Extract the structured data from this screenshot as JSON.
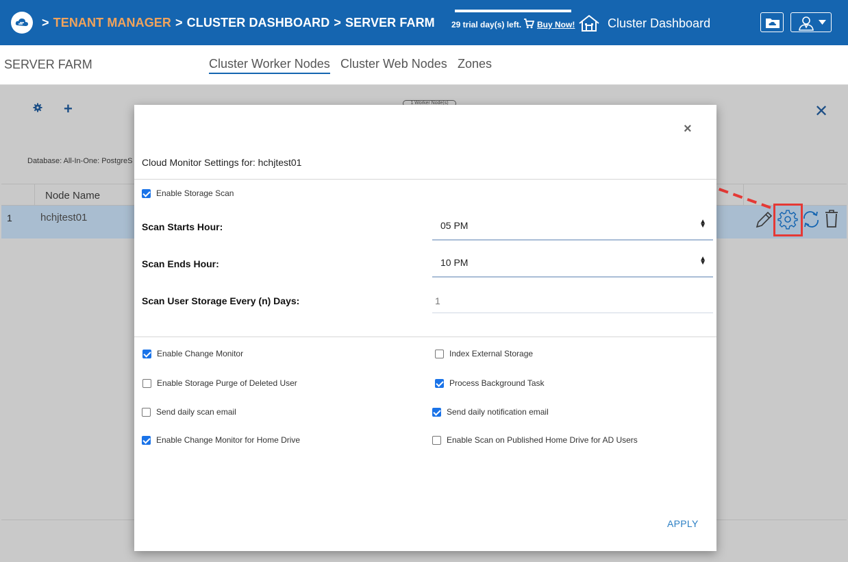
{
  "header": {
    "breadcrumbs": [
      {
        "label": "TENANT MANAGER",
        "color": "#f0a35c"
      },
      {
        "label": "CLUSTER DASHBOARD",
        "color": "#ffffff"
      },
      {
        "label": "SERVER FARM",
        "color": "#ffffff"
      }
    ],
    "separator": ">",
    "trial_text": "29 trial day(s) left.",
    "buy_now": "Buy Now!",
    "dashboard_title": "Cluster Dashboard",
    "icons": [
      "cloud-logo-icon",
      "cart-icon",
      "home-icon",
      "folder-cloud-icon",
      "user-icon",
      "caret-down-icon"
    ]
  },
  "subnav": {
    "title": "SERVER FARM",
    "tabs": [
      {
        "label": "Cluster Worker Nodes",
        "active": true
      },
      {
        "label": "Cluster Web Nodes",
        "active": false
      },
      {
        "label": "Zones",
        "active": false
      }
    ]
  },
  "background": {
    "badge": "1 Worker Node(s)",
    "database_text": "Database: All-In-One: PostgreS",
    "table": {
      "column_header": "Node Name",
      "rows": [
        {
          "index": "1",
          "name": "hchjtest01"
        }
      ]
    },
    "accent": "#1565b0"
  },
  "modal": {
    "title": "Cloud Monitor Settings for: hchjtest01",
    "enable_storage_scan": {
      "label": "Enable Storage Scan",
      "checked": true
    },
    "fields": {
      "scan_start": {
        "label": "Scan Starts Hour:",
        "value": "05 PM"
      },
      "scan_end": {
        "label": "Scan Ends Hour:",
        "value": "10 PM"
      },
      "scan_every": {
        "label": "Scan User Storage Every (n) Days:",
        "value": "1"
      }
    },
    "options_left": [
      {
        "label": "Enable Change Monitor",
        "checked": true
      },
      {
        "label": "Enable Storage Purge of Deleted User",
        "checked": false
      },
      {
        "label": "Send daily scan email",
        "checked": false
      },
      {
        "label": "Enable Change Monitor for Home Drive",
        "checked": true
      }
    ],
    "options_right": [
      {
        "label": "Index External Storage",
        "checked": false
      },
      {
        "label": "Process Background Task",
        "checked": true
      },
      {
        "label": "Send daily notification email",
        "checked": true
      },
      {
        "label": "Enable Scan on Published Home Drive for AD Users",
        "checked": false
      }
    ],
    "apply_label": "APPLY",
    "close_symbol": "×"
  },
  "annotation": {
    "arrow_color": "#e53935",
    "highlight": "gear-icon"
  }
}
